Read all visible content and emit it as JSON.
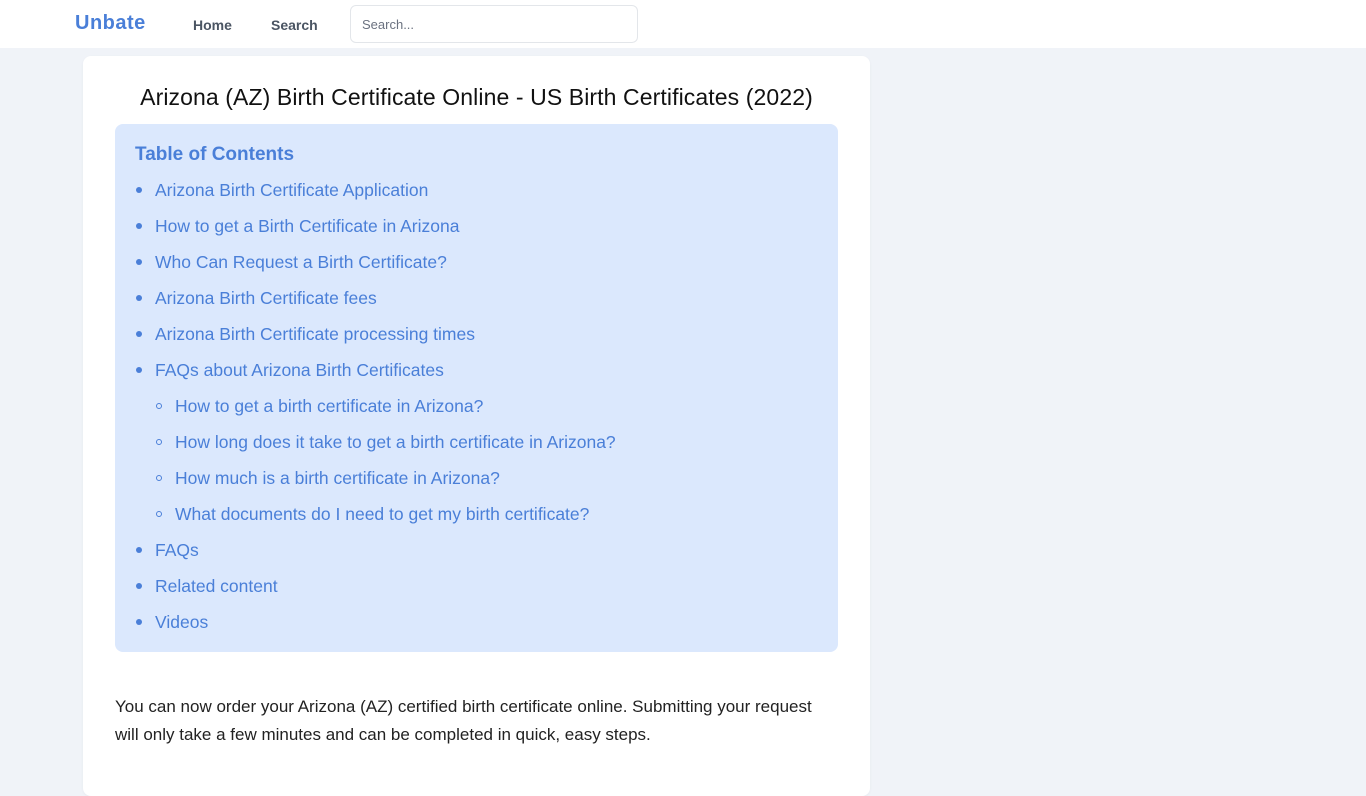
{
  "navbar": {
    "brand": "Unbate",
    "links": [
      {
        "label": "Home"
      },
      {
        "label": "Search"
      }
    ],
    "search": {
      "placeholder": "Search...",
      "value": ""
    }
  },
  "article": {
    "title": "Arizona (AZ) Birth Certificate Online - US Birth Certificates (2022)",
    "toc": {
      "title": "Table of Contents",
      "items": [
        {
          "label": "Arizona Birth Certificate Application",
          "level": 1
        },
        {
          "label": "How to get a Birth Certificate in Arizona",
          "level": 1
        },
        {
          "label": "Who Can Request a Birth Certificate?",
          "level": 1
        },
        {
          "label": "Arizona Birth Certificate fees",
          "level": 1
        },
        {
          "label": "Arizona Birth Certificate processing times",
          "level": 1
        },
        {
          "label": "FAQs about Arizona Birth Certificates",
          "level": 1
        },
        {
          "label": "How to get a birth certificate in Arizona?",
          "level": 2
        },
        {
          "label": "How long does it take to get a birth certificate in Arizona?",
          "level": 2
        },
        {
          "label": "How much is a birth certificate in Arizona?",
          "level": 2
        },
        {
          "label": "What documents do I need to get my birth certificate?",
          "level": 2
        },
        {
          "label": "FAQs",
          "level": 1
        },
        {
          "label": "Related content",
          "level": 1
        },
        {
          "label": "Videos",
          "level": 1
        }
      ]
    },
    "intro": "You can now order your Arizona (AZ) certified birth certificate online. Submitting your request will only take a few minutes and can be completed in quick, easy steps."
  },
  "colors": {
    "accent": "#4a7fd8",
    "toc_background": "#dbe8fd",
    "page_background": "#f0f3f8"
  }
}
